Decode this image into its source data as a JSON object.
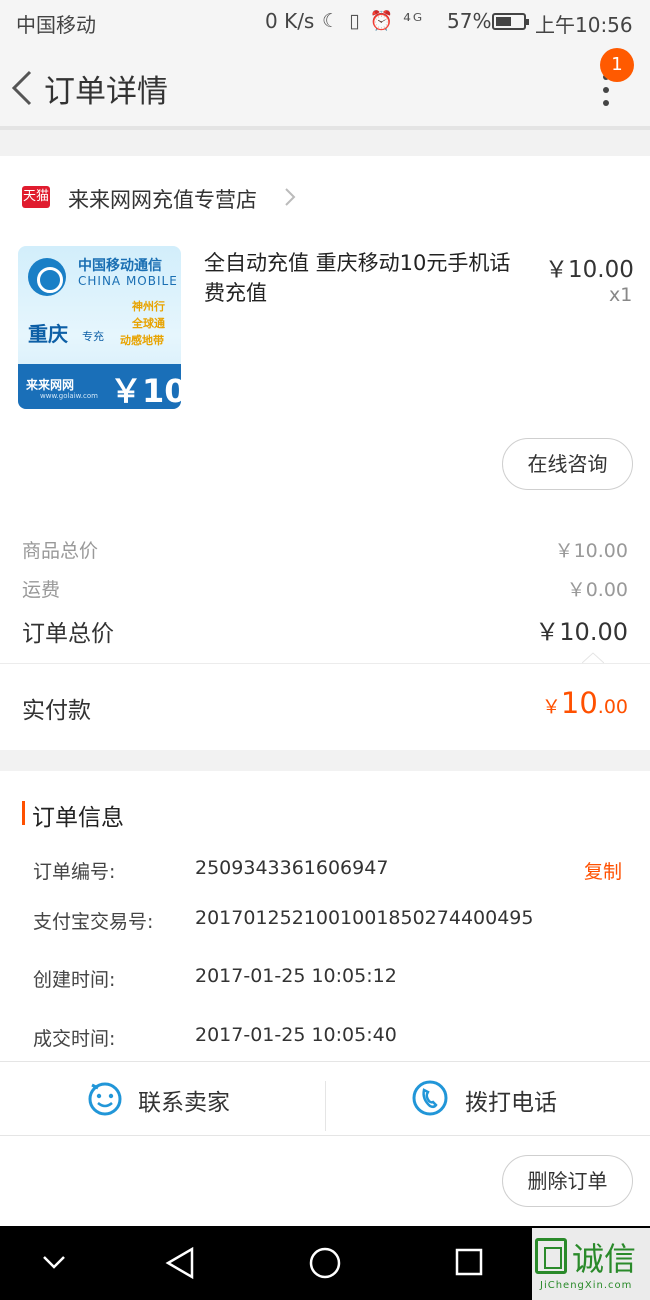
{
  "status_bar": {
    "carrier": "中国移动",
    "net_speed": "0 K/s",
    "status_icons": "☾ ▯ ⏰ ⁴ᴳ",
    "battery_percent": "57%",
    "battery_level": 0.57,
    "time": "上午10:56"
  },
  "header": {
    "title": "订单详情",
    "notification_count": "1",
    "back_icon": "chevron-left-icon",
    "more_icon": "more-vertical-icon"
  },
  "shop": {
    "badge": "天猫",
    "name": "来来网网充值专营店"
  },
  "product": {
    "name": "全自动充值 重庆移动10元手机话费充值",
    "price": "￥10.00",
    "quantity": "x1",
    "thumbnail": {
      "operator_cn": "中国移动通信",
      "operator_en": "CHINA MOBILE",
      "city": "重庆",
      "recharge_tag": "专充",
      "tags": [
        "神州行",
        "全球通",
        "动感地带"
      ],
      "brand": "来来网网",
      "website": "www.golaiw.com",
      "face_value": "￥10"
    }
  },
  "consult_button": "在线咨询",
  "price_summary": {
    "goods_total_label": "商品总价",
    "goods_total": "￥10.00",
    "shipping_label": "运费",
    "shipping": "￥0.00",
    "order_total_label": "订单总价",
    "order_total": "￥10.00",
    "paid_label": "实付款",
    "paid_currency": "￥",
    "paid_integer": "10",
    "paid_decimal": ".00"
  },
  "order_info": {
    "title": "订单信息",
    "copy_label": "复制",
    "rows": [
      {
        "label": "订单编号:",
        "value": "2509343361606947"
      },
      {
        "label": "支付宝交易号:",
        "value": "2017012521001001850274400495"
      },
      {
        "label": "创建时间:",
        "value": "2017-01-25 10:05:12"
      },
      {
        "label": "成交时间:",
        "value": "2017-01-25 10:05:40"
      }
    ]
  },
  "actions": {
    "contact_seller": "联系卖家",
    "call_phone": "拨打电话",
    "delete_order": "删除订单"
  },
  "watermark": {
    "text": "诚信",
    "url": "JiChengXin.com"
  },
  "colors": {
    "accent": "#ff5000",
    "badge": "#ff5a00",
    "tmall": "#e01b2e",
    "icon_blue": "#2196d8"
  }
}
